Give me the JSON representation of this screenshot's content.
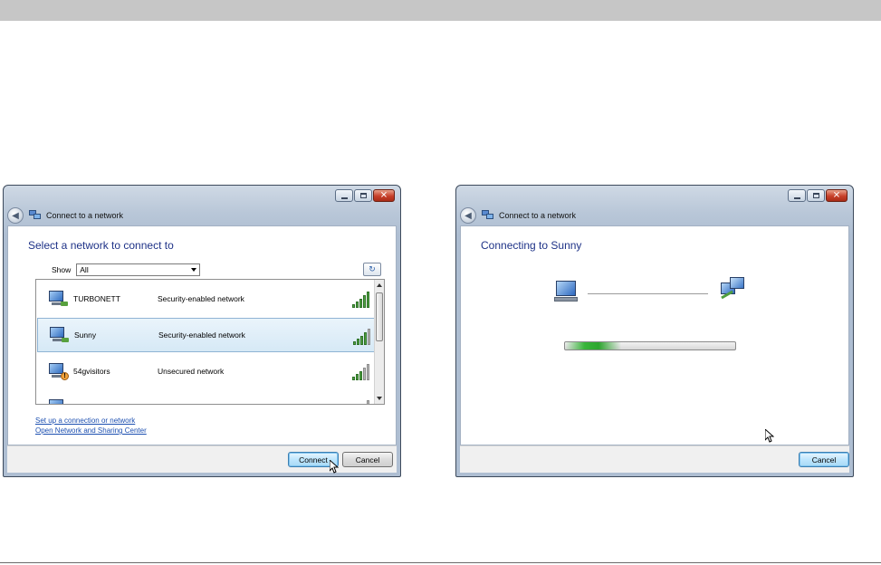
{
  "left_window": {
    "title": "Connect to a network",
    "heading": "Select a network to connect to",
    "show_label": "Show",
    "show_value": "All",
    "networks": [
      {
        "name": "TURBONETT",
        "security": "Security-enabled network",
        "signal_bars": 5,
        "selected": false,
        "icon": "wireless-network-icon"
      },
      {
        "name": "Sunny",
        "security": "Security-enabled network",
        "signal_bars": 4,
        "selected": true,
        "icon": "wireless-network-icon"
      },
      {
        "name": "54gvisitors",
        "security": "Unsecured network",
        "signal_bars": 3,
        "selected": false,
        "icon": "unsecured-network-warning-icon"
      }
    ],
    "link_setup": "Set up a connection or network",
    "link_center": "Open Network and Sharing Center",
    "connect_label": "Connect",
    "cancel_label": "Cancel"
  },
  "right_window": {
    "title": "Connect to a network",
    "heading": "Connecting to Sunny",
    "progress_fraction": 0.33,
    "cancel_label": "Cancel"
  },
  "colors": {
    "heading_blue": "#1e3287",
    "link_blue": "#1c4fb0",
    "progress_green": "#38b53a",
    "signal_green": "#4fa341"
  }
}
